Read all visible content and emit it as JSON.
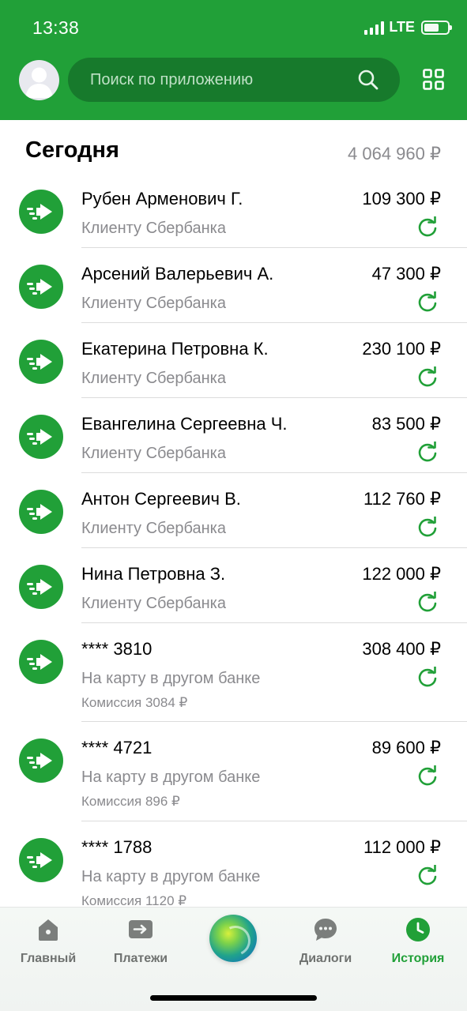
{
  "status": {
    "time": "13:38",
    "network": "LTE"
  },
  "search": {
    "placeholder": "Поиск по приложению"
  },
  "section": {
    "title": "Сегодня",
    "total": "4 064 960 ₽"
  },
  "transactions": [
    {
      "name": "Рубен Арменович Г.",
      "type": "Клиенту Сбербанка",
      "amount": "109 300 ₽"
    },
    {
      "name": "Арсений Валерьевич А.",
      "type": "Клиенту Сбербанка",
      "amount": "47 300 ₽"
    },
    {
      "name": "Екатерина Петровна К.",
      "type": "Клиенту Сбербанка",
      "amount": "230 100 ₽"
    },
    {
      "name": "Евангелина Сергеевна Ч.",
      "type": "Клиенту Сбербанка",
      "amount": "83 500 ₽"
    },
    {
      "name": "Антон Сергеевич В.",
      "type": "Клиенту Сбербанка",
      "amount": "112 760 ₽"
    },
    {
      "name": "Нина Петровна З.",
      "type": "Клиенту Сбербанка",
      "amount": "122 000 ₽"
    },
    {
      "name": "**** 3810",
      "type": "На карту в другом банке",
      "fee": "Комиссия 3084 ₽",
      "amount": "308 400 ₽"
    },
    {
      "name": "**** 4721",
      "type": "На карту в другом банке",
      "fee": "Комиссия 896 ₽",
      "amount": "89 600 ₽"
    },
    {
      "name": "**** 1788",
      "type": "На карту в другом банке",
      "fee": "Комиссия 1120 ₽",
      "amount": "112 000 ₽"
    }
  ],
  "tabs": [
    {
      "label": "Главный",
      "icon": "home-icon"
    },
    {
      "label": "Платежи",
      "icon": "payments-icon"
    },
    {
      "label": "",
      "icon": "sber-assistant-icon"
    },
    {
      "label": "Диалоги",
      "icon": "chat-icon"
    },
    {
      "label": "История",
      "icon": "clock-icon",
      "active": true
    }
  ],
  "colors": {
    "brand": "#21a038",
    "search_bg": "#177a2c",
    "muted": "#8a8a8e"
  }
}
